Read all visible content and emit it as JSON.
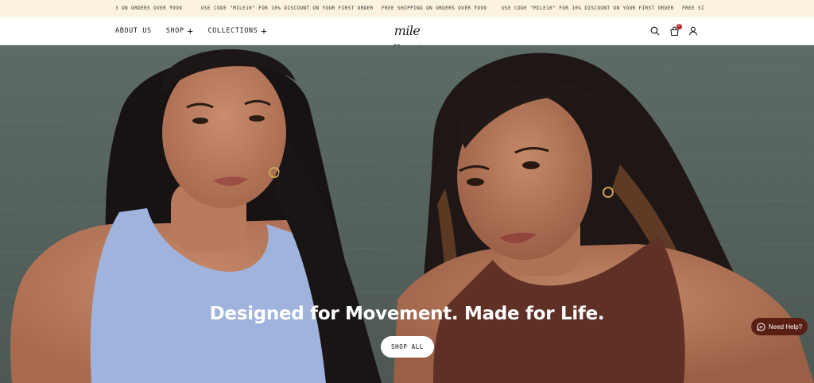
{
  "announcement": {
    "items": [
      "3 ON ORDERS OVER ₹999",
      "USE CODE \"MILE10\" FOR 10% DISCOUNT ON YOUR FIRST ORDER",
      "FREE SHIPPING ON ORDERS OVER ₹999",
      "USE CODE \"MILE10\" FOR 10% DISCOUNT ON YOUR FIRST ORDER",
      "FREE SI"
    ]
  },
  "header": {
    "nav": [
      {
        "label": "ABOUT US",
        "has_plus": false
      },
      {
        "label": "SHOP",
        "has_plus": true
      },
      {
        "label": "COLLECTIONS",
        "has_plus": true
      }
    ],
    "logo": "mile collective",
    "icons": [
      "search-icon",
      "cart-icon",
      "account-icon"
    ],
    "cart_count": "0"
  },
  "hero": {
    "headline": "Designed for Movement. Made for Life.",
    "cta_label": "SHOP ALL"
  },
  "help_widget": {
    "label": "Need Help?"
  },
  "colors": {
    "announcement_bg": "#fbf3df",
    "help_bg": "#5a1f14",
    "hero_bg": "#56605b",
    "bra_left": "#9fb3dd",
    "bra_right": "#5e3026"
  }
}
